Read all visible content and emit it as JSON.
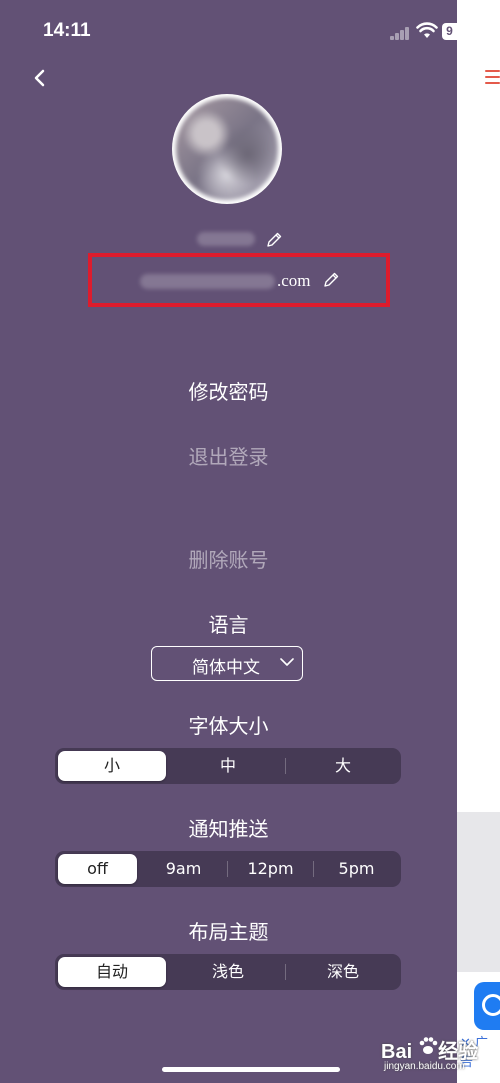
{
  "status_bar": {
    "time": "14:11",
    "battery": "9"
  },
  "profile": {
    "email_suffix": ".com"
  },
  "menu": {
    "change_password": "修改密码",
    "logout": "退出登录",
    "delete_account": "删除账号"
  },
  "language": {
    "title": "语言",
    "selected": "简体中文"
  },
  "font_size": {
    "title": "字体大小",
    "options": [
      "小",
      "中",
      "大"
    ],
    "selected": "小"
  },
  "notifications": {
    "title": "通知推送",
    "options": [
      "off",
      "9am",
      "12pm",
      "5pm"
    ],
    "selected": "off"
  },
  "theme": {
    "title": "布局主题",
    "options": [
      "自动",
      "浅色",
      "深色"
    ],
    "selected": "自动"
  },
  "side": {
    "ad_label": "广告"
  },
  "watermark": {
    "brand": "Bai",
    "brand_suffix": "经验",
    "site": "jingyan.baidu.com"
  },
  "colors": {
    "panel": "#625175",
    "segment_bg": "#463a55",
    "highlight_box": "#dd1c2d",
    "accent": "#e45a4b"
  }
}
